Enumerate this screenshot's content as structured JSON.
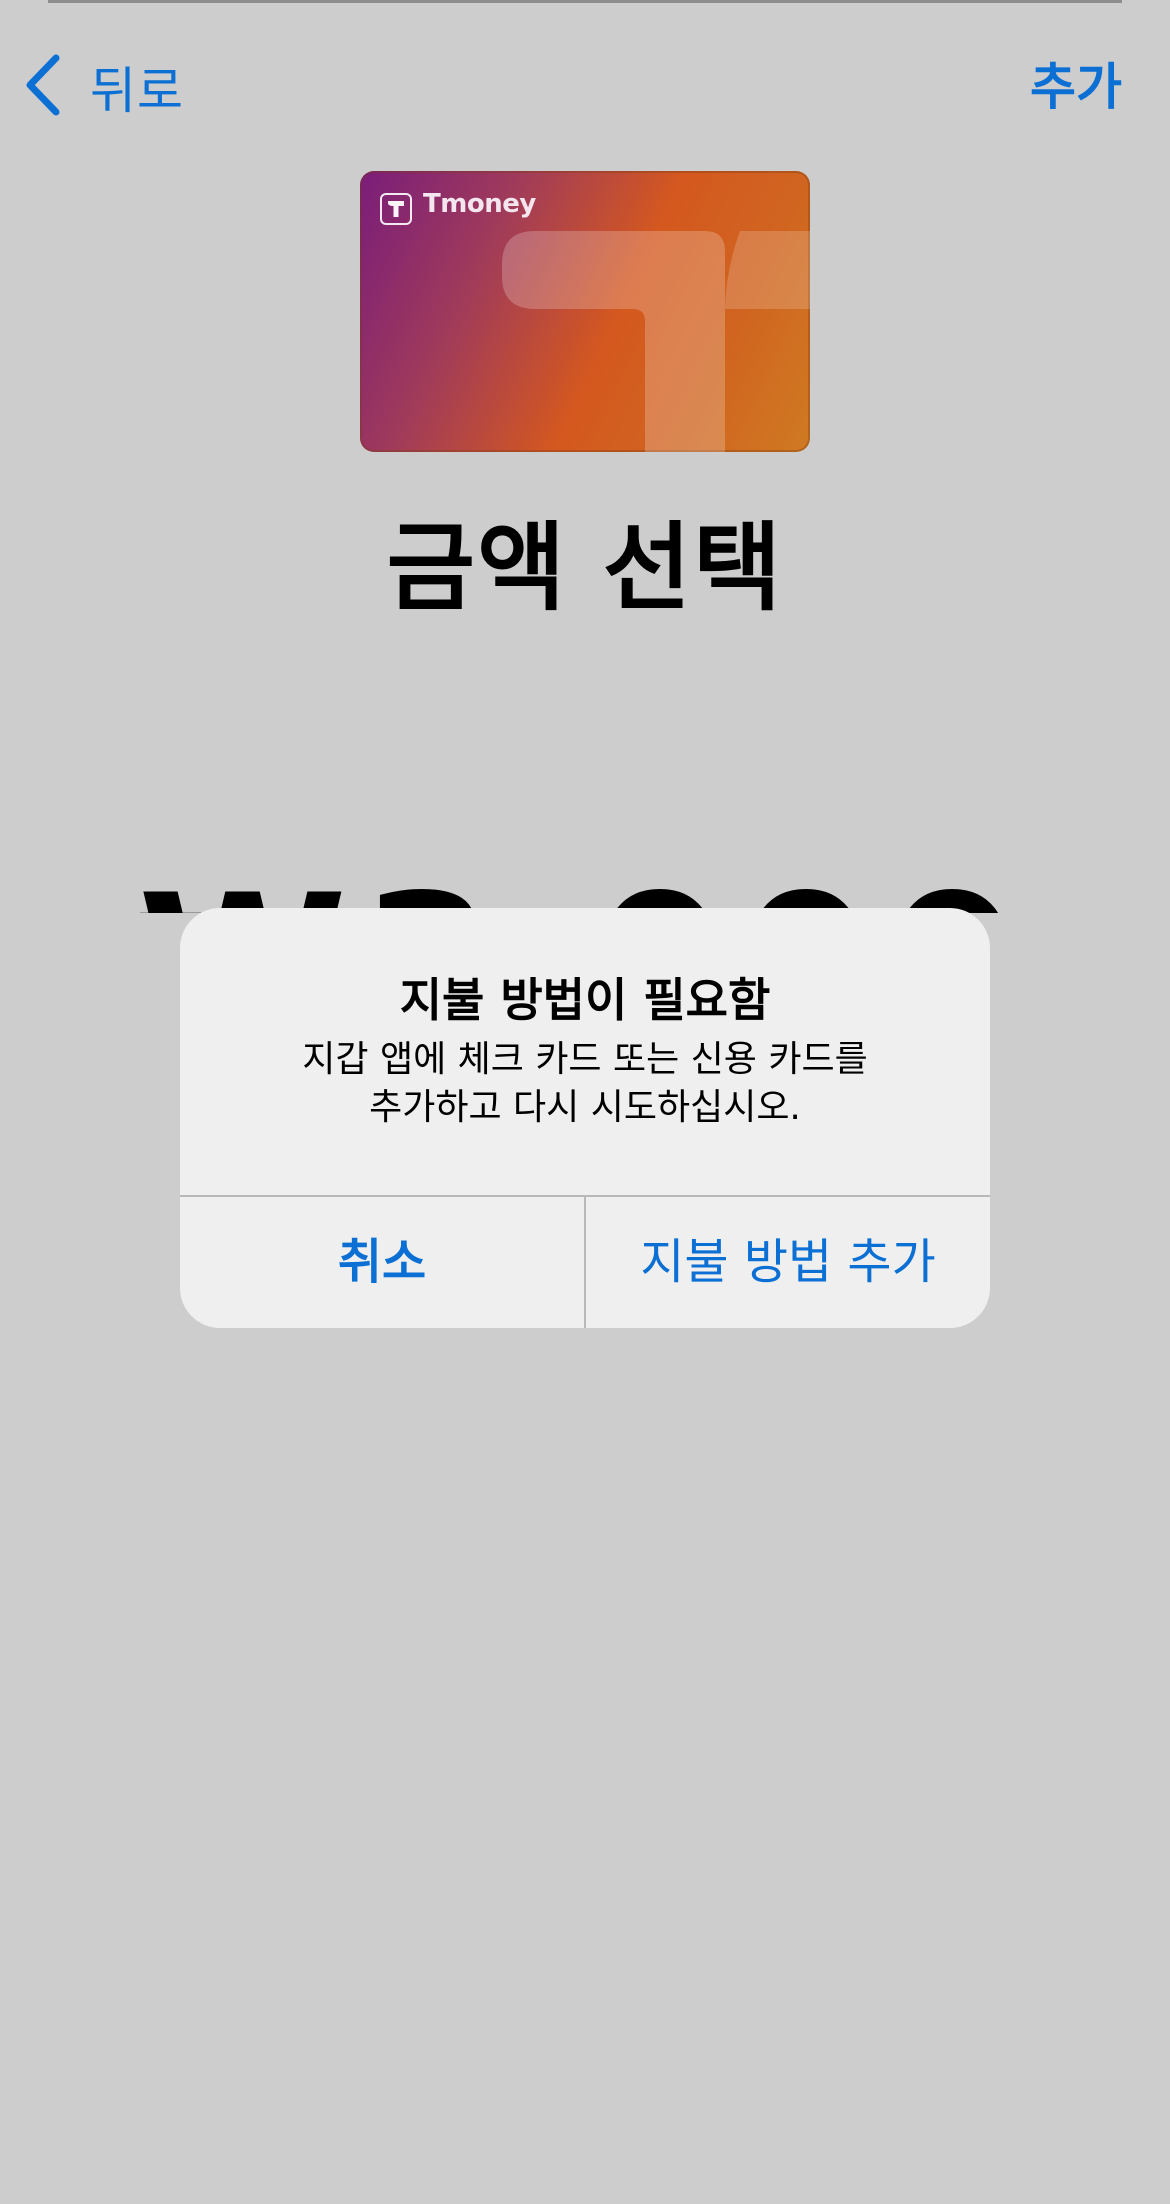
{
  "nav": {
    "back_label": "뒤로",
    "add_label": "추가"
  },
  "card": {
    "brand": "Tmoney"
  },
  "page": {
    "title": "금액 선택",
    "amount": "₩3,000"
  },
  "alert": {
    "title": "지불 방법이 필요함",
    "message_line1": "지갑 앱에 체크 카드 또는 신용 카드를",
    "message_line2": "추가하고 다시 시도하십시오.",
    "cancel_label": "취소",
    "add_payment_label": "지불 방법 추가"
  },
  "colors": {
    "accent": "#0b6fd4",
    "background": "#cdcdcd",
    "alert_background": "#efefef"
  }
}
